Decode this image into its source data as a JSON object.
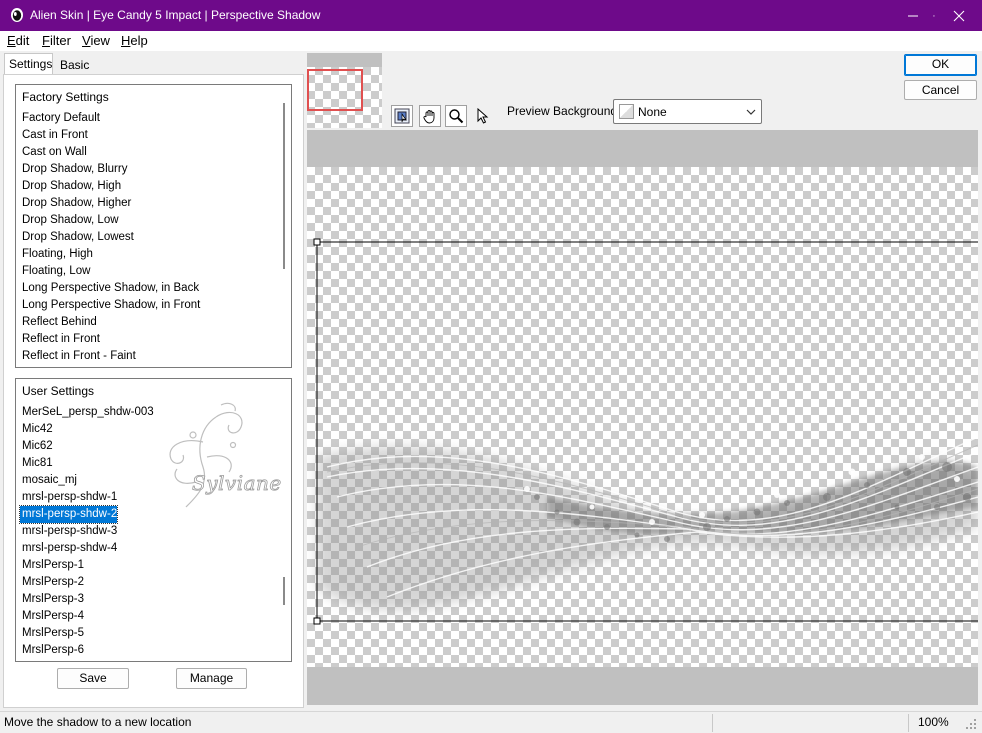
{
  "window": {
    "title": "Alien Skin | Eye Candy 5 Impact | Perspective Shadow",
    "accent_color": "#6e0a8a"
  },
  "menu": [
    {
      "label": "Edit",
      "mnemonic": "E",
      "rest": "dit"
    },
    {
      "label": "Filter",
      "mnemonic": "F",
      "rest": "ilter"
    },
    {
      "label": "View",
      "mnemonic": "V",
      "rest": "iew"
    },
    {
      "label": "Help",
      "mnemonic": "H",
      "rest": "elp"
    }
  ],
  "tabs": [
    {
      "label": "Settings",
      "active": true
    },
    {
      "label": "Basic",
      "active": false
    }
  ],
  "factory": {
    "header": "Factory Settings",
    "items": [
      "Factory Default",
      "Cast in Front",
      "Cast on Wall",
      "Drop Shadow, Blurry",
      "Drop Shadow, High",
      "Drop Shadow, Higher",
      "Drop Shadow, Low",
      "Drop Shadow, Lowest",
      "Floating, High",
      "Floating, Low",
      "Long Perspective Shadow, in Back",
      "Long Perspective Shadow, in Front",
      "Reflect Behind",
      "Reflect in Front",
      "Reflect in Front - Faint"
    ]
  },
  "user": {
    "header": "User Settings",
    "selected": "mrsl-persp-shdw-2",
    "items": [
      "MerSeL_persp_shdw-003",
      "Mic42",
      "Mic62",
      "Mic81",
      "mosaic_mj",
      "mrsl-persp-shdw-1",
      "mrsl-persp-shdw-2",
      "mrsl-persp-shdw-3",
      "mrsl-persp-shdw-4",
      "MrslPersp-1",
      "MrslPersp-2",
      "MrslPersp-3",
      "MrslPersp-4",
      "MrslPersp-5",
      "MrslPersp-6"
    ],
    "watermark": "Sylviane"
  },
  "buttons": {
    "save": "Save",
    "manage": "Manage",
    "ok": "OK",
    "cancel": "Cancel"
  },
  "toolbar": {
    "tools": [
      "navigate-icon",
      "hand-icon",
      "zoom-icon",
      "arrow-pointer-icon"
    ],
    "preview_bg_label": "Preview Background:",
    "preview_bg_value": "None"
  },
  "status": {
    "message": "Move the shadow to a new location",
    "zoom": "100%"
  }
}
